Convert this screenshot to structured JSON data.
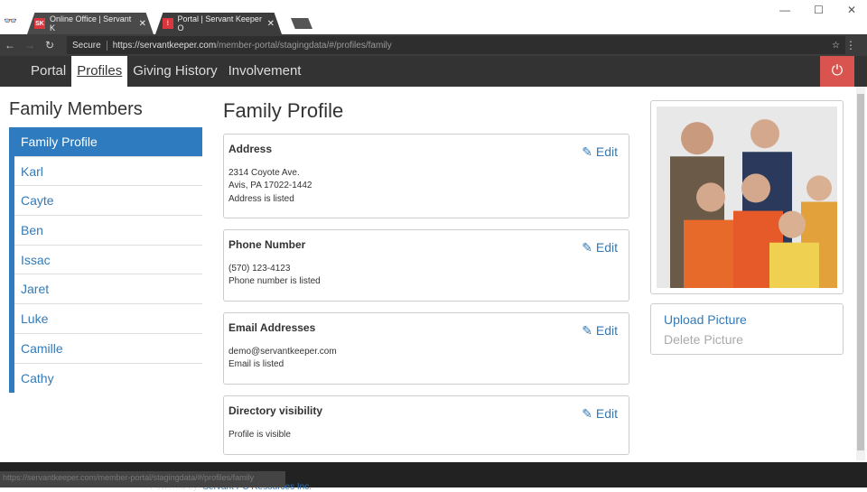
{
  "browser": {
    "tabs": [
      {
        "favicon": "SK",
        "title": "Online Office | Servant K"
      },
      {
        "favicon": "⁞",
        "title": "Portal | Servant Keeper O"
      }
    ],
    "secure": "Secure",
    "url_host": "https://servantkeeper.com",
    "url_path": "/member-portal/stagingdata/#/profiles/family",
    "status_url": "https://servantkeeper.com/member-portal/stagingdata/#/profiles/family"
  },
  "nav": {
    "items": [
      "Portal",
      "Profiles",
      "Giving History",
      "Involvement"
    ],
    "active": 1
  },
  "sidebar": {
    "title": "Family Members",
    "items": [
      "Family Profile",
      "Karl",
      "Cayte",
      "Ben",
      "Issac",
      "Jaret",
      "Luke",
      "Camille",
      "Cathy"
    ]
  },
  "main": {
    "title": "Family Profile",
    "edit_label": "Edit",
    "cards": [
      {
        "title": "Address",
        "lines": [
          "2314 Coyote Ave.",
          "Avis, PA 17022-1442",
          "Address is listed"
        ]
      },
      {
        "title": "Phone Number",
        "lines": [
          "(570) 123-4123",
          "Phone number is listed"
        ]
      },
      {
        "title": "Email Addresses",
        "lines": [
          "demo@servantkeeper.com",
          "Email is listed"
        ]
      },
      {
        "title": "Directory visibility",
        "lines": [
          "Profile is visible"
        ]
      }
    ]
  },
  "picture": {
    "upload": "Upload Picture",
    "delete": "Delete Picture"
  },
  "footer": {
    "powered": "Powered by: ",
    "company": "Servant PC Resources Inc."
  }
}
